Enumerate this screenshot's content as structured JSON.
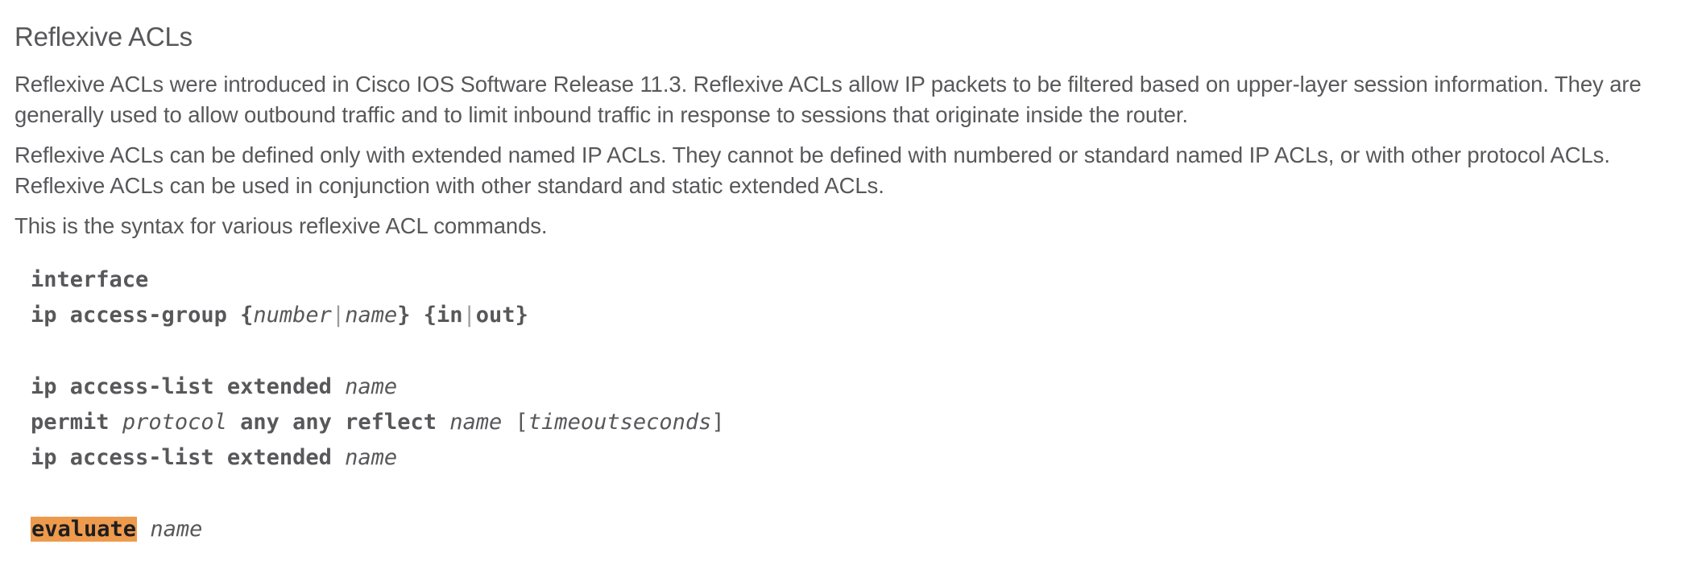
{
  "section": {
    "title": "Reflexive ACLs"
  },
  "paragraphs": [
    "Reflexive ACLs were introduced in Cisco IOS Software Release 11.3. Reflexive ACLs allow IP packets to be filtered based on upper-layer session information. They are generally used to allow outbound traffic and to limit inbound traffic in response to sessions that originate inside the router.",
    "Reflexive ACLs can be defined only with extended named IP ACLs. They cannot be defined with numbered or standard named IP ACLs, or with other protocol ACLs. Reflexive ACLs can be used in conjunction with other standard and static extended ACLs.",
    "This is the syntax for various reflexive ACL commands."
  ],
  "code": {
    "line1": {
      "kw": "interface"
    },
    "line2": {
      "kw1": "ip access-group",
      "brace_open1": "{",
      "arg1": "number",
      "bar1": "|",
      "arg2": "name",
      "brace_close1": "}",
      "brace_open2": "{",
      "opt1": "in",
      "bar2": "|",
      "opt2": "out",
      "brace_close2": "}"
    },
    "line3": {
      "kw": "ip access-list extended",
      "arg": "name"
    },
    "line4": {
      "kw1": "permit",
      "arg1": "protocol",
      "kw2": "any any reflect",
      "arg2": "name",
      "bracket_open": "[",
      "arg3": "timeoutseconds",
      "bracket_close": "]"
    },
    "line5": {
      "kw": "ip access-list extended",
      "arg": "name"
    },
    "line6": {
      "kw": "evaluate",
      "arg": "name"
    }
  },
  "colors": {
    "text": "#58585b",
    "highlight": "#ee9a4d"
  }
}
